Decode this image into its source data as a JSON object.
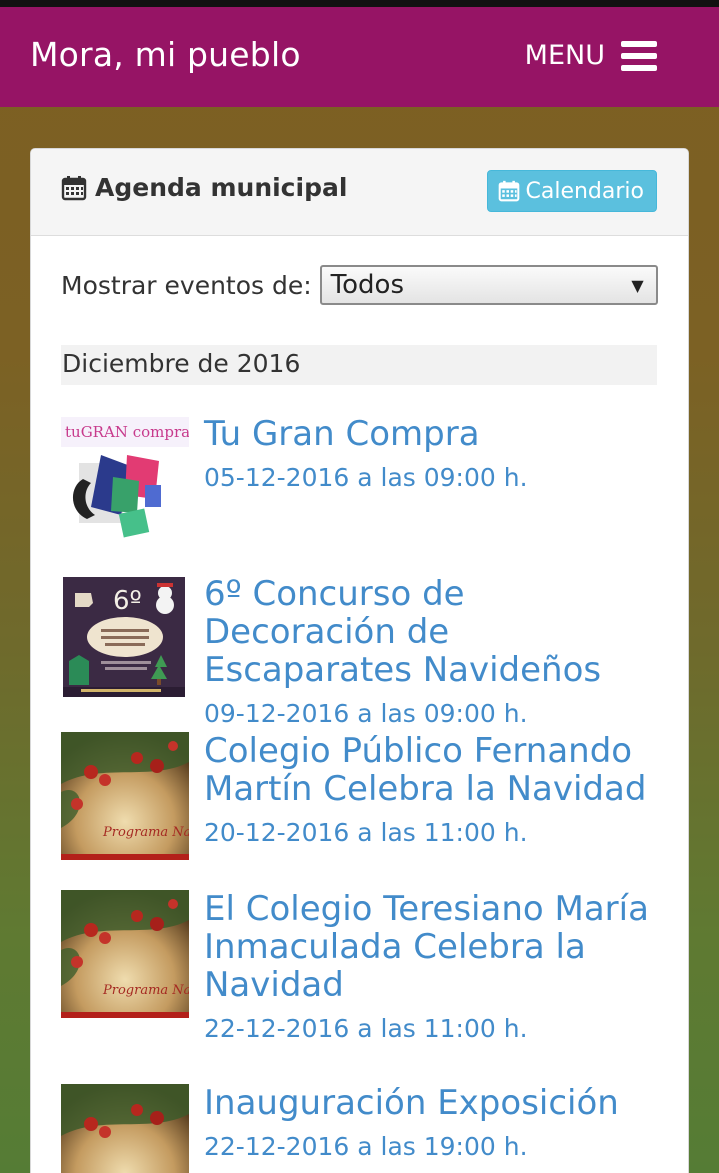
{
  "header": {
    "brand": "Mora, mi pueblo",
    "menu_label": "MENU"
  },
  "panel": {
    "title": "Agenda municipal",
    "calendar_button": "Calendario",
    "filter_label": "Mostrar eventos de:",
    "filter_selected": "Todos",
    "month_header": "Diciembre de 2016"
  },
  "events": [
    {
      "title": "Tu Gran Compra",
      "date": "05-12-2016 a las 09:00 h.",
      "thumb_text": "tuGRAN compra"
    },
    {
      "title": "6º Concurso de Decoración de Escaparates Navideños",
      "date": "09-12-2016 a las 09:00 h.",
      "thumb_text": "6º"
    },
    {
      "title": "Colegio Público Fernando Martín Celebra la Navidad",
      "date": "20-12-2016 a las 11:00 h.",
      "thumb_text": "Programa Navideño"
    },
    {
      "title": "El Colegio Teresiano María Inmaculada Celebra la Navidad",
      "date": "22-12-2016 a las 11:00 h.",
      "thumb_text": "Programa Navideño"
    },
    {
      "title": "Inauguración Exposición",
      "date": "22-12-2016 a las 19:00 h."
    }
  ],
  "colors": {
    "navbar": "#961465",
    "link": "#428bca",
    "button_info": "#5bc0de"
  },
  "icons": {
    "menu": "hamburger-icon",
    "calendar": "calendar-icon",
    "select_arrow": "dropdown-arrow-icon"
  }
}
